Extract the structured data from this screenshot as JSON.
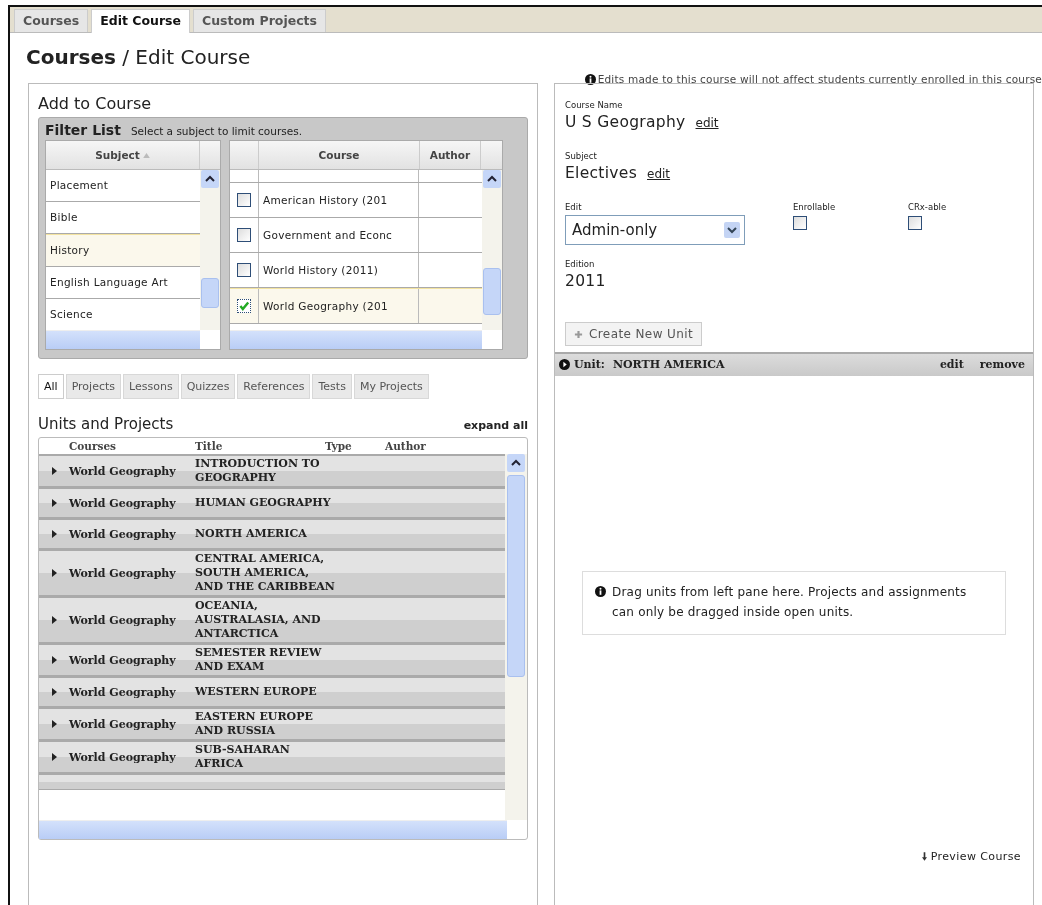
{
  "tabs": [
    {
      "label": "Courses",
      "selected": false
    },
    {
      "label": "Edit Course",
      "selected": true
    },
    {
      "label": "Custom Projects",
      "selected": false
    }
  ],
  "page_title": "**Courses** / Edit Course",
  "notice": "Edits made to this course will not affect students currently enrolled in this course",
  "add_panel": {
    "title": "Add to Course",
    "filter": {
      "title": "Filter List",
      "hint": "Select a subject to limit courses.",
      "subject_column": "Subject",
      "subjects": [
        {
          "name": "Placement",
          "selected": false
        },
        {
          "name": "Bible",
          "selected": false
        },
        {
          "name": "History",
          "selected": true
        },
        {
          "name": "English Language Art",
          "selected": false
        },
        {
          "name": "Science",
          "selected": false
        }
      ],
      "course_columns": [
        "Course",
        "Author"
      ],
      "courses": [
        {
          "name": "American History (201",
          "checked": false,
          "selected": false
        },
        {
          "name": "Government and Econc",
          "checked": false,
          "selected": false
        },
        {
          "name": "World History (2011)",
          "checked": false,
          "selected": false
        },
        {
          "name": "World Geography (201",
          "checked": true,
          "selected": true
        }
      ]
    },
    "type_tabs": [
      {
        "label": "All",
        "selected": true
      },
      {
        "label": "Projects",
        "selected": false
      },
      {
        "label": "Lessons",
        "selected": false
      },
      {
        "label": "Quizzes",
        "selected": false
      },
      {
        "label": "References",
        "selected": false
      },
      {
        "label": "Tests",
        "selected": false
      },
      {
        "label": "My Projects",
        "selected": false
      }
    ],
    "units_title": "Units and Projects",
    "expand_all": "expand all",
    "units_columns": [
      "Courses",
      "Title",
      "Type",
      "Author"
    ],
    "units": [
      {
        "course": "World Geography",
        "title": "INTRODUCTION TO GEOGRAPHY"
      },
      {
        "course": "World Geography",
        "title": "HUMAN GEOGRAPHY"
      },
      {
        "course": "World Geography",
        "title": "NORTH AMERICA"
      },
      {
        "course": "World Geography",
        "title": "CENTRAL AMERICA, SOUTH AMERICA, AND THE CARIBBEAN"
      },
      {
        "course": "World Geography",
        "title": "OCEANIA, AUSTRALASIA, AND ANTARCTICA"
      },
      {
        "course": "World Geography",
        "title": "SEMESTER REVIEW AND EXAM"
      },
      {
        "course": "World Geography",
        "title": "WESTERN EUROPE"
      },
      {
        "course": "World Geography",
        "title": "EASTERN EUROPE AND RUSSIA"
      },
      {
        "course": "World Geography",
        "title": "SUB-SAHARAN AFRICA"
      }
    ]
  },
  "course_panel": {
    "course_name": {
      "label": "Course Name",
      "value": "U S Geography",
      "action": "edit"
    },
    "subject": {
      "label": "Subject",
      "value": "Electives",
      "action": "edit"
    },
    "edit": {
      "label": "Edit",
      "value": "Admin-only"
    },
    "enrollable": {
      "label": "Enrollable",
      "checked": false
    },
    "crx": {
      "label": "CRx-able",
      "checked": false
    },
    "edition": {
      "label": "Edition",
      "value": "2011"
    },
    "create_button": "Create New Unit",
    "unit": {
      "prefix": "Unit:",
      "name": "NORTH AMERICA",
      "actions": [
        "edit",
        "remove"
      ]
    },
    "drop_hint": "Drag units from left pane here. Projects and assignments can only be dragged inside open units.",
    "preview": "Preview Course"
  }
}
